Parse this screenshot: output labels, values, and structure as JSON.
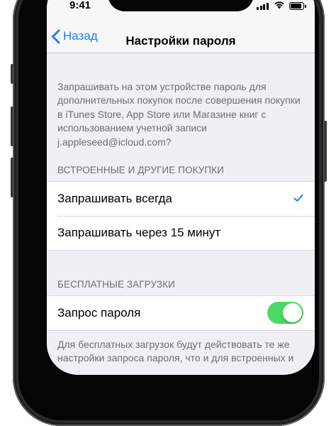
{
  "status_bar": {
    "time": "9:41",
    "battery_level": 0.9
  },
  "nav": {
    "back_label": "Назад",
    "title": "Настройки пароля"
  },
  "description": "Запрашивать на этом устройстве пароль для дополнительных покупок после совершения покупки в iTunes Store, App Store или Магазине книг с использованием учетной записи j.appleseed@icloud.com?",
  "purchases_section": {
    "header": "ВСТРОЕННЫЕ И ДРУГИЕ ПОКУПКИ",
    "options": [
      {
        "label": "Запрашивать всегда",
        "selected": true
      },
      {
        "label": "Запрашивать через 15 минут",
        "selected": false
      }
    ]
  },
  "free_downloads_section": {
    "header": "БЕСПЛАТНЫЕ ЗАГРУЗКИ",
    "password_request_label": "Запрос пароля",
    "password_request_on": true,
    "footer": "Для бесплатных загрузок будут действовать те же настройки запроса пароля, что и для встроенных и"
  },
  "colors": {
    "accent": "#1d7ef4",
    "toggle_on": "#4cd964",
    "background": "#efeff4",
    "secondary_text": "#6d6d72"
  },
  "icons": {
    "back": "chevron-left-icon",
    "selected": "checkmark-icon",
    "signal": "cellular-signal-icon",
    "wifi": "wifi-icon",
    "battery": "battery-icon"
  }
}
